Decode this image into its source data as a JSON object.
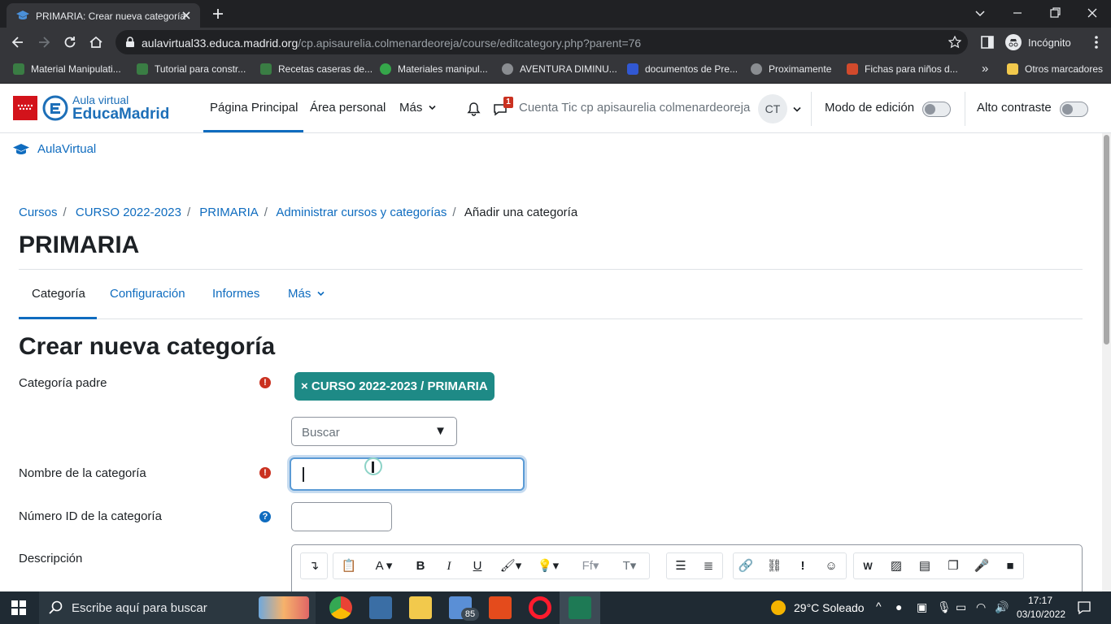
{
  "browser": {
    "tab_title": "PRIMARIA: Crear nueva categoría",
    "url_domain": "aulavirtual33.educa.madrid.org",
    "url_path": "/cp.apisaurelia.colmenardeoreja/course/editcategory.php?parent=76",
    "profile": "Incógnito",
    "bookmarks": [
      "Material Manipulati...",
      "Tutorial para constr...",
      "Recetas caseras de...",
      "Materiales manipul...",
      "AVENTURA DIMINU...",
      "documentos de Pre...",
      "Proximamente",
      "Fichas para niños d..."
    ],
    "bookmarks_more": "»",
    "other_bookmarks": "Otros marcadores"
  },
  "navbar": {
    "logo_line1": "Aula virtual",
    "logo_line2": "EducaMadrid",
    "items": [
      "Página Principal",
      "Área personal",
      "Más"
    ],
    "messages_count": "1",
    "user_name": "Cuenta Tic cp apisaurelia colmenardeoreja",
    "user_initials": "CT",
    "edit_mode_label": "Modo de edición",
    "high_contrast_label": "Alto contraste"
  },
  "site_link": "AulaVirtual",
  "breadcrumb": [
    "Cursos",
    "CURSO 2022-2023",
    "PRIMARIA",
    "Administrar cursos y categorías",
    "Añadir una categoría"
  ],
  "page_title": "PRIMARIA",
  "secondary_tabs": [
    "Categoría",
    "Configuración",
    "Informes",
    "Más"
  ],
  "form": {
    "title": "Crear nueva categoría",
    "parent_label": "Categoría padre",
    "parent_value": "× CURSO 2022-2023 / PRIMARIA",
    "search_placeholder": "Buscar",
    "name_label": "Nombre de la categoría",
    "idnumber_label": "Número ID de la categoría",
    "description_label": "Descripción"
  },
  "taskbar": {
    "search_placeholder": "Escribe aquí para buscar",
    "mail_badge": "85",
    "weather": "29°C  Soleado",
    "time": "17:17",
    "date": "03/10/2022"
  },
  "colors": {
    "accent": "#0f6cbf",
    "badge": "#1e8a86",
    "required": "#ca3120"
  }
}
